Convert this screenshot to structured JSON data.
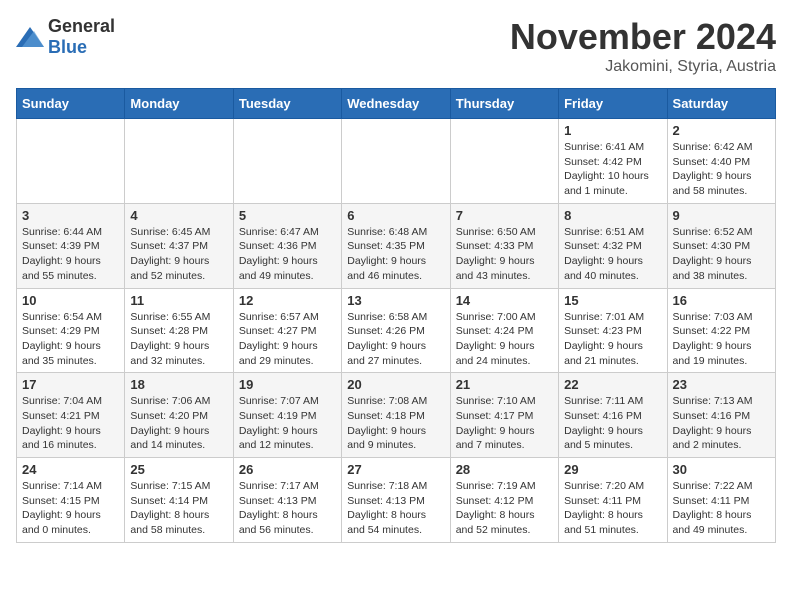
{
  "logo": {
    "general": "General",
    "blue": "Blue"
  },
  "title": "November 2024",
  "location": "Jakomini, Styria, Austria",
  "days_of_week": [
    "Sunday",
    "Monday",
    "Tuesday",
    "Wednesday",
    "Thursday",
    "Friday",
    "Saturday"
  ],
  "weeks": [
    [
      {
        "day": "",
        "info": ""
      },
      {
        "day": "",
        "info": ""
      },
      {
        "day": "",
        "info": ""
      },
      {
        "day": "",
        "info": ""
      },
      {
        "day": "",
        "info": ""
      },
      {
        "day": "1",
        "info": "Sunrise: 6:41 AM\nSunset: 4:42 PM\nDaylight: 10 hours and 1 minute."
      },
      {
        "day": "2",
        "info": "Sunrise: 6:42 AM\nSunset: 4:40 PM\nDaylight: 9 hours and 58 minutes."
      }
    ],
    [
      {
        "day": "3",
        "info": "Sunrise: 6:44 AM\nSunset: 4:39 PM\nDaylight: 9 hours and 55 minutes."
      },
      {
        "day": "4",
        "info": "Sunrise: 6:45 AM\nSunset: 4:37 PM\nDaylight: 9 hours and 52 minutes."
      },
      {
        "day": "5",
        "info": "Sunrise: 6:47 AM\nSunset: 4:36 PM\nDaylight: 9 hours and 49 minutes."
      },
      {
        "day": "6",
        "info": "Sunrise: 6:48 AM\nSunset: 4:35 PM\nDaylight: 9 hours and 46 minutes."
      },
      {
        "day": "7",
        "info": "Sunrise: 6:50 AM\nSunset: 4:33 PM\nDaylight: 9 hours and 43 minutes."
      },
      {
        "day": "8",
        "info": "Sunrise: 6:51 AM\nSunset: 4:32 PM\nDaylight: 9 hours and 40 minutes."
      },
      {
        "day": "9",
        "info": "Sunrise: 6:52 AM\nSunset: 4:30 PM\nDaylight: 9 hours and 38 minutes."
      }
    ],
    [
      {
        "day": "10",
        "info": "Sunrise: 6:54 AM\nSunset: 4:29 PM\nDaylight: 9 hours and 35 minutes."
      },
      {
        "day": "11",
        "info": "Sunrise: 6:55 AM\nSunset: 4:28 PM\nDaylight: 9 hours and 32 minutes."
      },
      {
        "day": "12",
        "info": "Sunrise: 6:57 AM\nSunset: 4:27 PM\nDaylight: 9 hours and 29 minutes."
      },
      {
        "day": "13",
        "info": "Sunrise: 6:58 AM\nSunset: 4:26 PM\nDaylight: 9 hours and 27 minutes."
      },
      {
        "day": "14",
        "info": "Sunrise: 7:00 AM\nSunset: 4:24 PM\nDaylight: 9 hours and 24 minutes."
      },
      {
        "day": "15",
        "info": "Sunrise: 7:01 AM\nSunset: 4:23 PM\nDaylight: 9 hours and 21 minutes."
      },
      {
        "day": "16",
        "info": "Sunrise: 7:03 AM\nSunset: 4:22 PM\nDaylight: 9 hours and 19 minutes."
      }
    ],
    [
      {
        "day": "17",
        "info": "Sunrise: 7:04 AM\nSunset: 4:21 PM\nDaylight: 9 hours and 16 minutes."
      },
      {
        "day": "18",
        "info": "Sunrise: 7:06 AM\nSunset: 4:20 PM\nDaylight: 9 hours and 14 minutes."
      },
      {
        "day": "19",
        "info": "Sunrise: 7:07 AM\nSunset: 4:19 PM\nDaylight: 9 hours and 12 minutes."
      },
      {
        "day": "20",
        "info": "Sunrise: 7:08 AM\nSunset: 4:18 PM\nDaylight: 9 hours and 9 minutes."
      },
      {
        "day": "21",
        "info": "Sunrise: 7:10 AM\nSunset: 4:17 PM\nDaylight: 9 hours and 7 minutes."
      },
      {
        "day": "22",
        "info": "Sunrise: 7:11 AM\nSunset: 4:16 PM\nDaylight: 9 hours and 5 minutes."
      },
      {
        "day": "23",
        "info": "Sunrise: 7:13 AM\nSunset: 4:16 PM\nDaylight: 9 hours and 2 minutes."
      }
    ],
    [
      {
        "day": "24",
        "info": "Sunrise: 7:14 AM\nSunset: 4:15 PM\nDaylight: 9 hours and 0 minutes."
      },
      {
        "day": "25",
        "info": "Sunrise: 7:15 AM\nSunset: 4:14 PM\nDaylight: 8 hours and 58 minutes."
      },
      {
        "day": "26",
        "info": "Sunrise: 7:17 AM\nSunset: 4:13 PM\nDaylight: 8 hours and 56 minutes."
      },
      {
        "day": "27",
        "info": "Sunrise: 7:18 AM\nSunset: 4:13 PM\nDaylight: 8 hours and 54 minutes."
      },
      {
        "day": "28",
        "info": "Sunrise: 7:19 AM\nSunset: 4:12 PM\nDaylight: 8 hours and 52 minutes."
      },
      {
        "day": "29",
        "info": "Sunrise: 7:20 AM\nSunset: 4:11 PM\nDaylight: 8 hours and 51 minutes."
      },
      {
        "day": "30",
        "info": "Sunrise: 7:22 AM\nSunset: 4:11 PM\nDaylight: 8 hours and 49 minutes."
      }
    ]
  ]
}
